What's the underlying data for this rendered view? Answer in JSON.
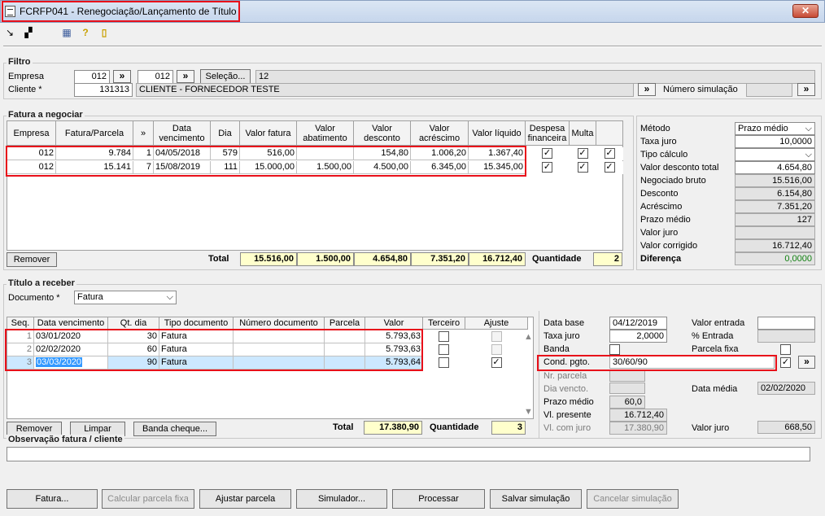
{
  "window": {
    "title": "FCRFP041 - Renegociação/Lançamento de Título",
    "close": "✕"
  },
  "toolbar": {
    "icons": [
      "export-icon",
      "window-icon",
      "calculator-icon",
      "help-icon",
      "exit-icon"
    ],
    "calc_glyph": "▦",
    "help_glyph": "?",
    "exit_glyph": "▯",
    "arrow_glyph": "↘",
    "win_glyph": "▞"
  },
  "filtro": {
    "title": "Filtro",
    "empresa_label": "Empresa",
    "empresa_value": "012",
    "empresa2_value": "012",
    "selecao_label": "Seleção...",
    "selecao_value": "12",
    "cliente_label": "Cliente *",
    "cliente_code": "131313",
    "cliente_name": "CLIENTE - FORNECEDOR TESTE",
    "numero_simulacao_label": "Número simulação",
    "numero_simulacao_value": "",
    "lookup": "»"
  },
  "fatura": {
    "title": "Fatura a negociar",
    "headers": [
      "Empresa",
      "Fatura/Parcela",
      "»",
      "Data vencimento",
      "Dia",
      "Valor fatura",
      "Valor abatimento",
      "Valor desconto",
      "Valor acréscimo",
      "Valor líquido",
      "Despesa financeira",
      "Multa",
      ""
    ],
    "rows": [
      {
        "empresa": "012",
        "fatura": "9.784",
        "parcela": "1",
        "data": "04/05/2018",
        "dia": "579",
        "valor_fatura": "516,00",
        "abatimento": "",
        "desconto": "154,80",
        "acrescimo": "1.006,20",
        "liquido": "1.367,40",
        "despesa": true,
        "multa": true,
        "extra": true
      },
      {
        "empresa": "012",
        "fatura": "15.141",
        "parcela": "7",
        "data": "15/08/2019",
        "dia": "111",
        "valor_fatura": "15.000,00",
        "abatimento": "1.500,00",
        "desconto": "4.500,00",
        "acrescimo": "6.345,00",
        "liquido": "15.345,00",
        "despesa": true,
        "multa": true,
        "extra": true
      }
    ],
    "remover": "Remover",
    "total_label": "Total",
    "total_fatura": "15.516,00",
    "total_abatimento": "1.500,00",
    "total_desconto": "4.654,80",
    "total_acrescimo": "7.351,20",
    "total_liquido": "16.712,40",
    "quantidade_label": "Quantidade",
    "quantidade": "2"
  },
  "resumo": {
    "metodo_label": "Método",
    "metodo": "Prazo médio",
    "taxa_label": "Taxa juro",
    "taxa": "10,0000",
    "tipo_label": "Tipo cálculo",
    "tipo": "",
    "vdt_label": "Valor desconto total",
    "vdt": "4.654,80",
    "nb_label": "Negociado bruto",
    "nb": "15.516,00",
    "desc_label": "Desconto",
    "desc": "6.154,80",
    "acr_label": "Acréscimo",
    "acr": "7.351,20",
    "pm_label": "Prazo médio",
    "pm": "127",
    "vj_label": "Valor juro",
    "vj": "",
    "vc_label": "Valor corrigido",
    "vc": "16.712,40",
    "dif_label": "Diferença",
    "dif": "0,0000",
    "dif_color": "#108010"
  },
  "titulo": {
    "title": "Título a receber",
    "documento_label": "Documento *",
    "documento": "Fatura",
    "headers": [
      "Seq.",
      "Data vencimento",
      "Qt. dia",
      "Tipo documento",
      "Número documento",
      "Parcela",
      "Valor",
      "Terceiro",
      "Ajuste"
    ],
    "rows": [
      {
        "seq": "1",
        "data": "03/01/2020",
        "qt": "30",
        "tipo": "Fatura",
        "numero": "",
        "parcela": "",
        "valor": "5.793,63",
        "terceiro": false,
        "ajuste": false
      },
      {
        "seq": "2",
        "data": "02/02/2020",
        "qt": "60",
        "tipo": "Fatura",
        "numero": "",
        "parcela": "",
        "valor": "5.793,63",
        "terceiro": false,
        "ajuste": false
      },
      {
        "seq": "3",
        "data": "03/03/2020",
        "qt": "90",
        "tipo": "Fatura",
        "numero": "",
        "parcela": "",
        "valor": "5.793,64",
        "terceiro": false,
        "ajuste": true
      }
    ],
    "remover": "Remover",
    "limpar": "Limpar",
    "banda_cheque": "Banda cheque...",
    "total_label": "Total",
    "total": "17.380,90",
    "quantidade_label": "Quantidade",
    "quantidade": "3"
  },
  "parametros": {
    "data_base_label": "Data base",
    "data_base": "04/12/2019",
    "valor_entrada_label": "Valor entrada",
    "valor_entrada": "",
    "taxa_label": "Taxa juro",
    "taxa": "2,0000",
    "pct_entrada_label": "% Entrada",
    "pct_entrada": "",
    "banda_label": "Banda",
    "parcela_fixa_label": "Parcela fixa",
    "cond_label": "Cond. pgto.",
    "cond": "30/60/90",
    "nr_parcela_label": "Nr. parcela",
    "dia_vencto_label": "Dia vencto.",
    "data_media_label": "Data média",
    "data_media": "02/02/2020",
    "prazo_label": "Prazo médio",
    "prazo": "60,0",
    "vp_label": "Vl. presente",
    "vp": "16.712,40",
    "vcj_label": "Vl. com juro",
    "vcj": "17.380,90",
    "valor_juro_label": "Valor juro",
    "valor_juro": "668,50"
  },
  "observacao": {
    "title": "Observação fatura / cliente",
    "value": ""
  },
  "footer": {
    "fatura": "Fatura...",
    "calcular": "Calcular parcela fixa",
    "ajustar": "Ajustar parcela",
    "simulador": "Simulador...",
    "processar": "Processar",
    "salvar": "Salvar simulação",
    "cancelar": "Cancelar simulação"
  },
  "colors": {
    "highlight": "#e8101a",
    "row_select": "#cce8ff",
    "selected_text": "#3399ff",
    "total_bg": "#ffffcc"
  }
}
